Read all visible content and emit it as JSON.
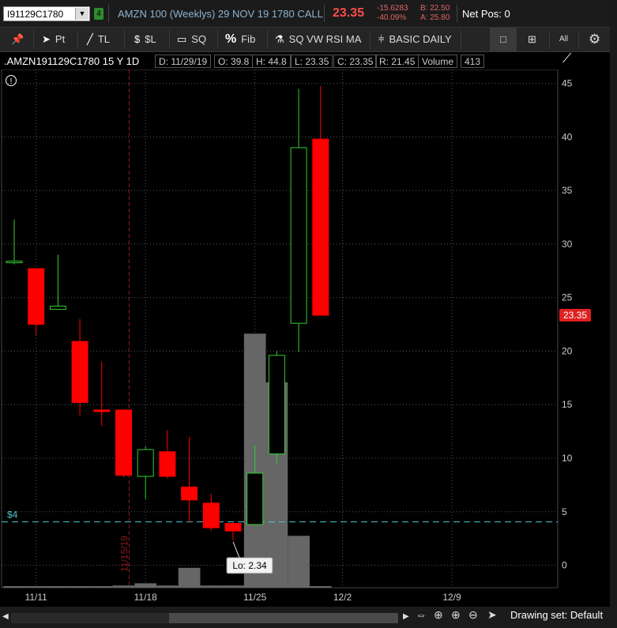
{
  "header": {
    "symbol": "I91129C1780",
    "description": "AMZN 100 (Weeklys) 29 NOV 19 1780 CALL",
    "last_price": "23.35",
    "change": "-15.6283",
    "change_pct": "-40.09%",
    "bid": "B: 22.50",
    "ask": "A: 25.80",
    "net_pos": "Net Pos: 0"
  },
  "toolbar": {
    "pt": "Pt",
    "tl": "TL",
    "dl": "$L",
    "sq": "SQ",
    "fib": "Fib",
    "studies": "SQ VW RSI MA",
    "style": "BASIC DAILY",
    "all": "All"
  },
  "infobar": {
    "symbol": ".AMZN191129C1780 15 Y 1D",
    "date": "D: 11/29/19",
    "open": "O: 39.8",
    "high": "H: 44.8",
    "low": "L: 23.35",
    "close": "C: 23.35",
    "range": "R: 21.45",
    "volume_label": "Volume",
    "volume": "413"
  },
  "bottom": {
    "drawing_set": "Drawing set: Default"
  },
  "colors": {
    "up": "#33cc33",
    "down": "#ff0000",
    "volume": "#666666",
    "price_line": "#4cc7cf",
    "last_tag": "#e02020"
  },
  "chart_data": {
    "type": "candlestick",
    "ylim": [
      -2,
      46
    ],
    "y_ticks": [
      0,
      5,
      10,
      15,
      20,
      25,
      30,
      35,
      40,
      45
    ],
    "x_ticks": [
      {
        "label": "11/11",
        "x": 1
      },
      {
        "label": "11/18",
        "x": 6
      },
      {
        "label": "11/25",
        "x": 11
      },
      {
        "label": "12/2",
        "x": 15
      },
      {
        "label": "12/9",
        "x": 20
      }
    ],
    "vline": {
      "label": "11/15/19",
      "x": 5.25
    },
    "hline": {
      "label": "$4",
      "value": 4.05
    },
    "last_price_tag": "23.35",
    "low_callout": {
      "label": "Lo: 2.34",
      "x": 10
    },
    "candles": [
      {
        "x": 0,
        "o": 28.4,
        "h": 32.3,
        "l": 28.1,
        "c": 28.4,
        "v": 0
      },
      {
        "x": 1,
        "o": 27.7,
        "h": 27.7,
        "l": 21.5,
        "c": 22.5,
        "v": 0
      },
      {
        "x": 2,
        "o": 23.9,
        "h": 29.0,
        "l": 23.9,
        "c": 24.2,
        "v": 1
      },
      {
        "x": 3,
        "o": 20.9,
        "h": 23.0,
        "l": 14.0,
        "c": 15.2,
        "v": 5
      },
      {
        "x": 4,
        "o": 14.5,
        "h": 19.0,
        "l": 13.0,
        "c": 14.4,
        "v": 3
      },
      {
        "x": 5,
        "o": 14.5,
        "h": 14.5,
        "l": 8.2,
        "c": 8.4,
        "v": 10
      },
      {
        "x": 6,
        "o": 8.3,
        "h": 11.1,
        "l": 6.2,
        "c": 10.8,
        "v": 20
      },
      {
        "x": 7,
        "o": 10.6,
        "h": 12.6,
        "l": 8.1,
        "c": 8.3,
        "v": 10
      },
      {
        "x": 8,
        "o": 7.3,
        "h": 12.0,
        "l": 4.0,
        "c": 6.1,
        "v": 90
      },
      {
        "x": 9,
        "o": 5.8,
        "h": 6.7,
        "l": 3.2,
        "c": 3.5,
        "v": 10
      },
      {
        "x": 10,
        "o": 3.9,
        "h": 4.0,
        "l": 2.34,
        "c": 3.2,
        "v": 10
      },
      {
        "x": 11,
        "o": 3.8,
        "h": 11.2,
        "l": 3.7,
        "c": 8.6,
        "v": 1150
      },
      {
        "x": 12,
        "o": 10.4,
        "h": 20.0,
        "l": 9.4,
        "c": 19.6,
        "v": 930
      },
      {
        "x": 13,
        "o": 22.6,
        "h": 44.5,
        "l": 19.9,
        "c": 39.0,
        "v": 235
      },
      {
        "x": 14,
        "o": 39.8,
        "h": 44.8,
        "l": 23.35,
        "c": 23.35,
        "v": 1
      }
    ]
  }
}
